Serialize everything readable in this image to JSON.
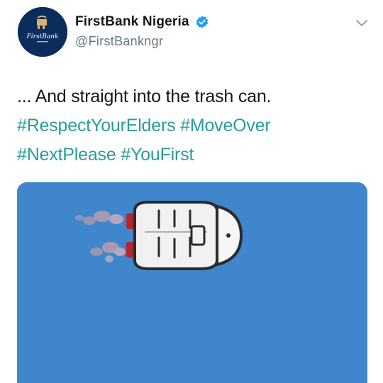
{
  "account": {
    "display_name": "FirstBank Nigeria",
    "handle": "@FirstBankngr",
    "verified": true,
    "avatar_text": "FirstBank",
    "avatar_color": "#0b2d5c"
  },
  "tweet": {
    "text_line1": "... And straight into the trash can.",
    "hashtags_line2": [
      "#RespectYourElders",
      "#MoveOver"
    ],
    "hashtags_line3": [
      "#NextPlease",
      "#YouFirst"
    ]
  },
  "media": {
    "background_color": "#3f86cc",
    "subject": "trash-can-rocket-icon"
  },
  "colors": {
    "hashtag": "#2a9d9b",
    "verified_badge": "#1da1f2",
    "text": "#14171a",
    "secondary": "#657786"
  }
}
